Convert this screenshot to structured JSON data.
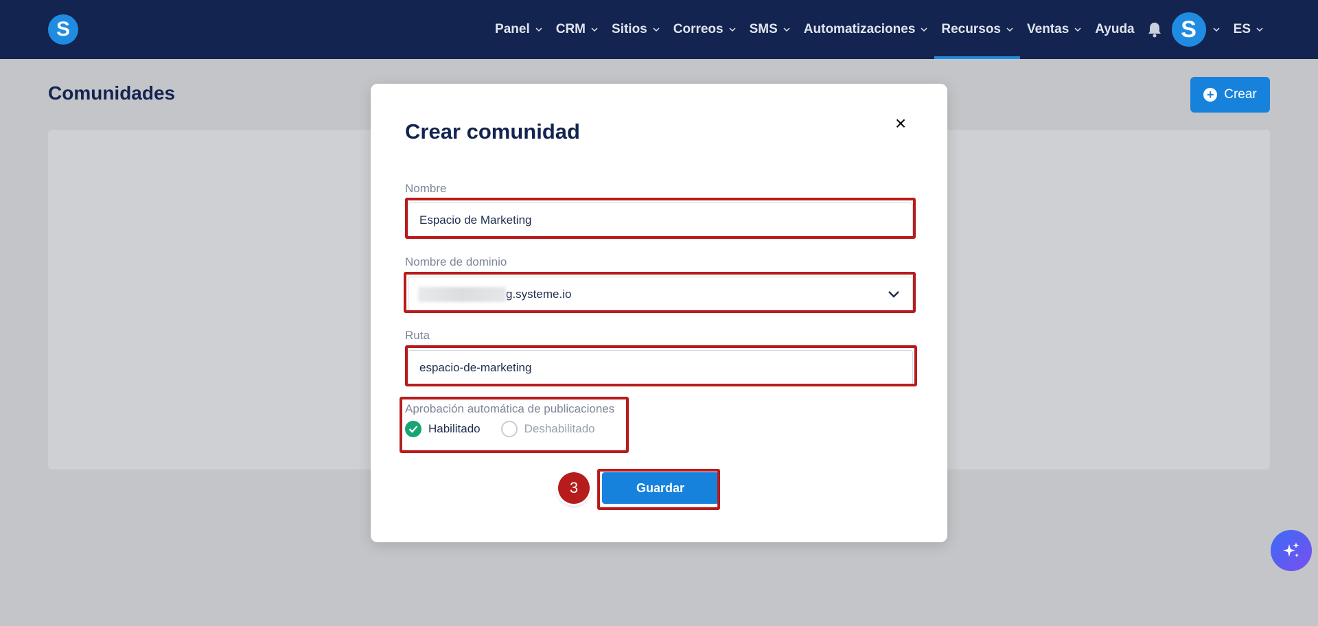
{
  "nav": {
    "items": [
      {
        "label": "Panel",
        "dropdown": true
      },
      {
        "label": "CRM",
        "dropdown": true
      },
      {
        "label": "Sitios",
        "dropdown": true
      },
      {
        "label": "Correos",
        "dropdown": true
      },
      {
        "label": "SMS",
        "dropdown": true
      },
      {
        "label": "Automatizaciones",
        "dropdown": true
      },
      {
        "label": "Recursos",
        "dropdown": true,
        "active": true
      },
      {
        "label": "Ventas",
        "dropdown": true
      },
      {
        "label": "Ayuda",
        "dropdown": false
      }
    ],
    "language": "ES",
    "logo_letter": "S",
    "avatar_letter": "S"
  },
  "page": {
    "title": "Comunidades",
    "create_label": "Crear"
  },
  "modal": {
    "title": "Crear comunidad",
    "close": "×",
    "name_label": "Nombre",
    "name_value": "Espacio de Marketing",
    "domain_label": "Nombre de dominio",
    "domain_value_suffix": "g.systeme.io",
    "path_label": "Ruta",
    "path_value": "espacio-de-marketing",
    "auto_approval_label": "Aprobación automática de publicaciones",
    "option_enabled": "Habilitado",
    "option_disabled": "Deshabilitado",
    "selected_option": "Habilitado",
    "save_label": "Guardar"
  },
  "annotation": {
    "step_number": "3"
  },
  "colors": {
    "navbar": "#132450",
    "primary": "#1782db",
    "highlight": "#b71c1c",
    "success": "#17a673"
  }
}
